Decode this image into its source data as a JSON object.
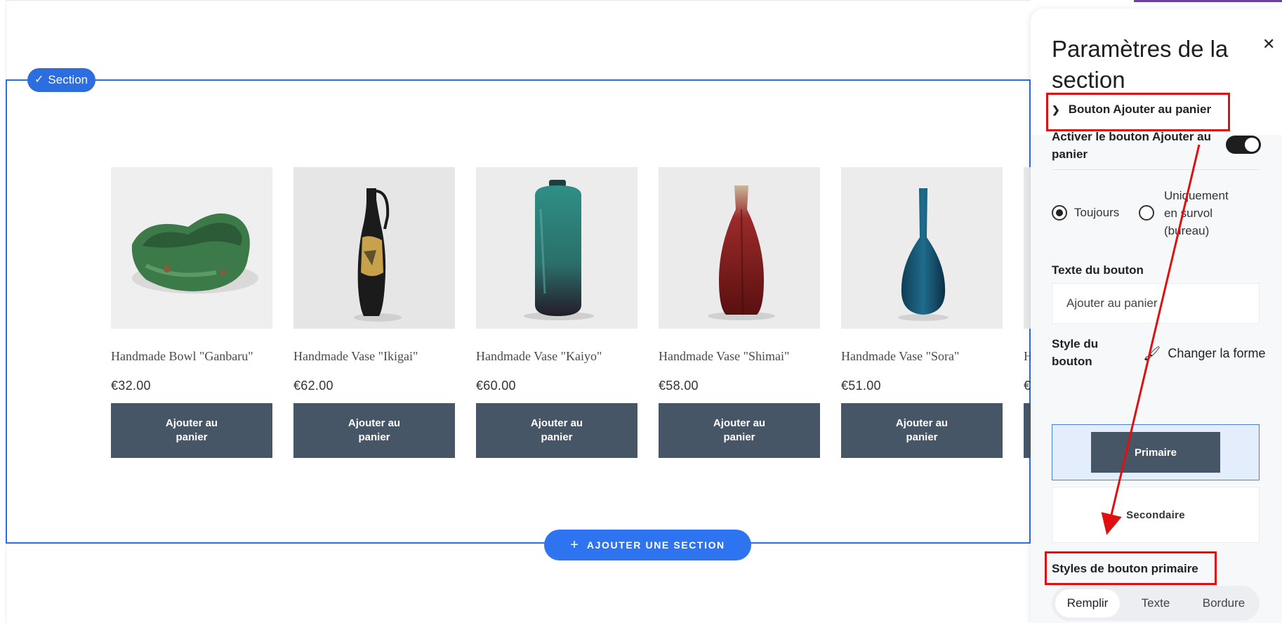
{
  "section_tag": {
    "label": "Section"
  },
  "products": [
    {
      "name": "Handmade Bowl \"Ganbaru\"",
      "price": "€32.00",
      "button": "Ajouter au panier"
    },
    {
      "name": "Handmade Vase \"Ikigai\"",
      "price": "€62.00",
      "button": "Ajouter au panier"
    },
    {
      "name": "Handmade Vase \"Kaiyo\"",
      "price": "€60.00",
      "button": "Ajouter au panier"
    },
    {
      "name": "Handmade Vase \"Shimai\"",
      "price": "€58.00",
      "button": "Ajouter au panier"
    },
    {
      "name": "Handmade Vase \"Sora\"",
      "price": "€51.00",
      "button": "Ajouter au panier"
    },
    {
      "name": "H",
      "price": "€",
      "button": ""
    }
  ],
  "add_section": {
    "label": "AJOUTER UNE SECTION"
  },
  "panel": {
    "title": "Paramètres de la section",
    "close_icon": "close-icon",
    "accordion": "Bouton Ajouter au panier",
    "toggle_label": "Activer le bouton Ajouter au panier",
    "toggle_on": true,
    "radio_always": "Toujours",
    "radio_hover": "Uniquement en survol (bureau)",
    "text_label": "Texte du bouton",
    "text_value": "Ajouter au panier",
    "style_label": "Style du bouton",
    "change_shape": "Changer la forme",
    "style_primary": "Primaire",
    "style_secondary": "Secondaire",
    "primary_styles_label": "Styles de bouton primaire",
    "segments": [
      "Remplir",
      "Texte",
      "Bordure"
    ],
    "active_segment": "Remplir"
  },
  "colors": {
    "accent": "#2c6ee0",
    "button_bg": "#475667",
    "annotation": "#e01010"
  }
}
